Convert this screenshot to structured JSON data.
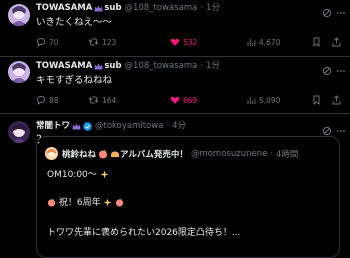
{
  "tweets": [
    {
      "name": "TOWASAMA",
      "sub": "sub",
      "handle": "@108_towasama",
      "separator": "·",
      "time": "1分",
      "text": "いきたくねえ〜〜",
      "replies": "70",
      "retweets": "123",
      "likes": "532",
      "views": "4,670"
    },
    {
      "name": "TOWASAMA",
      "sub": "sub",
      "handle": "@108_towasama",
      "separator": "·",
      "time": "1分",
      "text": "キモすぎるねねね",
      "replies": "88",
      "retweets": "164",
      "likes": "669",
      "views": "5,090"
    },
    {
      "name": "常闇トワ",
      "handle": "@tokoyamitowa",
      "separator": "·",
      "time": "4分",
      "text": "？"
    }
  ],
  "quote": {
    "name": "桃鈴ねね",
    "name_tail": "アルバム発売中！",
    "handle": "@momosuzunene",
    "separator": "·",
    "time": "4時間",
    "line1": "OM10:00〜",
    "line2": "祝！6周年",
    "line3": "トワワ先輩に褒められたい2026限定凸待ち！..."
  },
  "colors": {
    "background": "#000000",
    "text": "#e7e9ea",
    "muted": "#71767b",
    "like_active": "#f91880",
    "verified_blue": "#1d9bf0",
    "divider": "#2f3336"
  },
  "icons": [
    "reply-icon",
    "retweet-icon",
    "heart-icon",
    "views-icon",
    "bookmark-icon",
    "share-icon",
    "grok-icon",
    "more-icon",
    "verified-badge-icon",
    "sparkle-icon",
    "peach-icon"
  ]
}
